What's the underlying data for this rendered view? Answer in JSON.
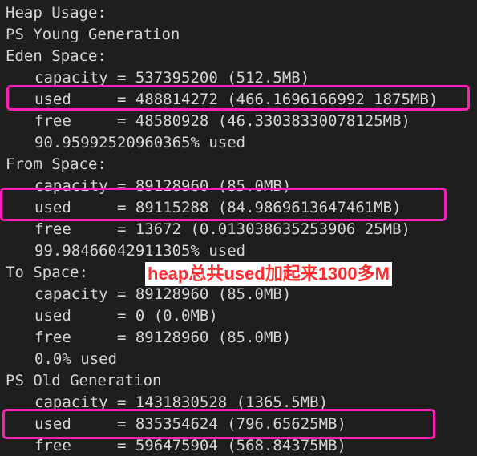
{
  "output": {
    "heap_usage": "Heap Usage:",
    "young_gen": "PS Young Generation",
    "eden": {
      "title": "Eden Space:",
      "capacity": "capacity = 537395200 (512.5MB)",
      "used": "used     = 488814272 (466.1696166992 1875MB)",
      "free": "free     = 48580928 (46.33038330078125MB)",
      "pct": "90.95992520960365% used"
    },
    "from": {
      "title": "From Space:",
      "capacity": "capacity = 89128960 (85.0MB)",
      "used": "used     = 89115288 (84.9869613647461MB)",
      "free": "free     = 13672 (0.013038635253906 25MB)",
      "pct": "99.98466042911305% used"
    },
    "to": {
      "title": "To Space:",
      "capacity": "capacity = 89128960 (85.0MB)",
      "used": "used     = 0 (0.0MB)",
      "free": "free     = 89128960 (85.0MB)",
      "pct": "0.0% used"
    },
    "old_gen": {
      "title": "PS Old Generation",
      "capacity": "capacity = 1431830528 (1365.5MB)",
      "used": "used     = 835354624 (796.65625MB)",
      "free": "free     = 596475904 (568.84375MB)"
    }
  },
  "annotation": {
    "text": "heap总共used加起来1300多M",
    "color": "#ff2d2d"
  },
  "highlight_color": "#ff1fb8"
}
